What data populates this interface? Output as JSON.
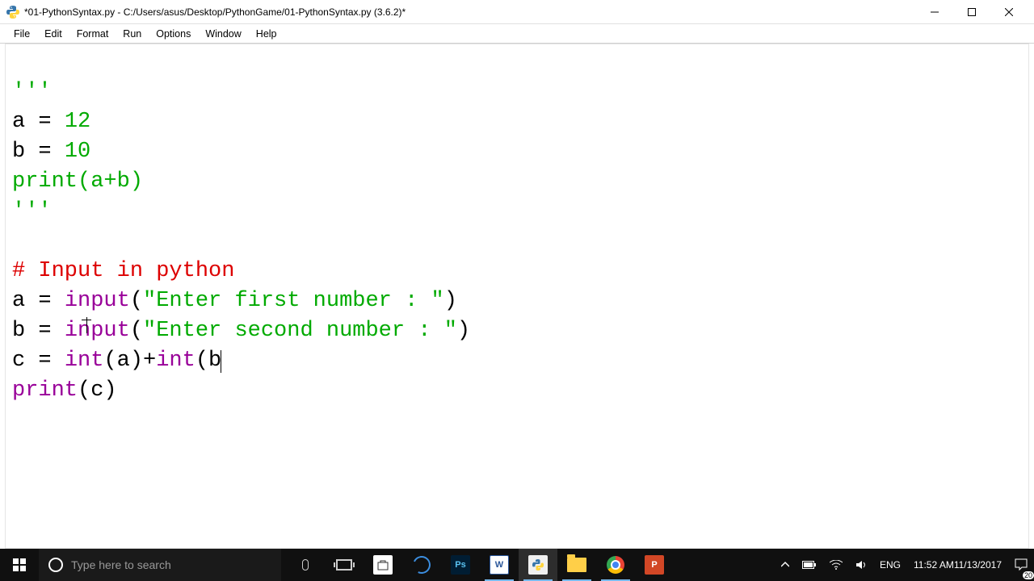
{
  "window": {
    "title": "*01-PythonSyntax.py - C:/Users/asus/Desktop/PythonGame/01-PythonSyntax.py (3.6.2)*"
  },
  "menu": {
    "items": [
      "File",
      "Edit",
      "Format",
      "Run",
      "Options",
      "Window",
      "Help"
    ]
  },
  "code": {
    "l1": "'''",
    "l2a": "a = ",
    "l2b": "12",
    "l3a": "b = ",
    "l3b": "10",
    "l4a": "print",
    "l4b": "(a+b)",
    "l5": "'''",
    "l6": "",
    "l7": "# Input in python",
    "l8a": "a = ",
    "l8b": "input",
    "l8c": "(",
    "l8d": "\"Enter first number : \"",
    "l8e": ")",
    "l9a": "b = ",
    "l9b": "input",
    "l9c": "(",
    "l9d": "\"Enter second number : \"",
    "l9e": ")",
    "l10a": "c = ",
    "l10b": "int",
    "l10c": "(a)+",
    "l10d": "int",
    "l10e": "(b",
    "l11a": "print",
    "l11b": "(c)"
  },
  "taskbar": {
    "search_placeholder": "Type here to search",
    "lang": "ENG",
    "time": "11:52 AM",
    "date": "11/13/2017",
    "notif_count": "20"
  }
}
